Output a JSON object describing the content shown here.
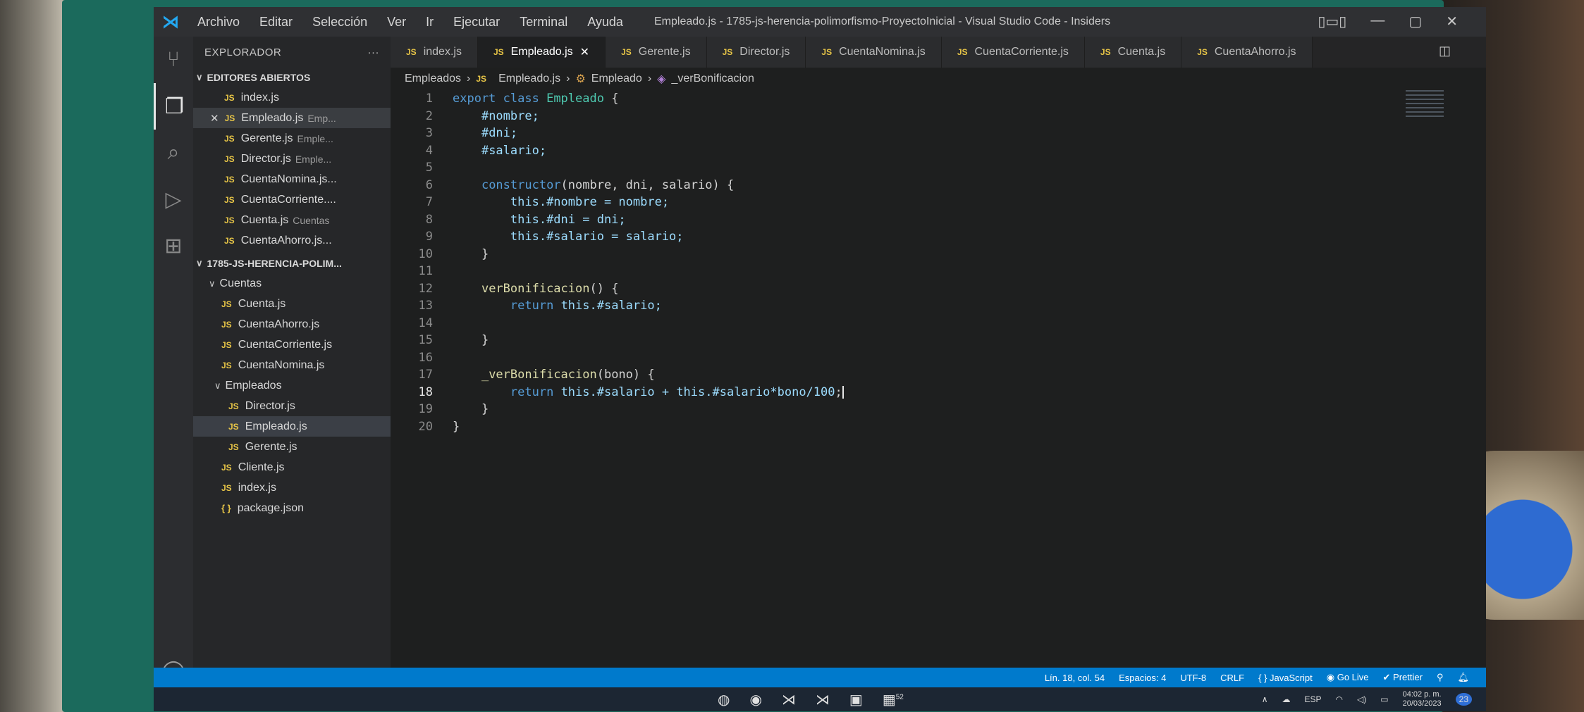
{
  "titlebar": {
    "menu": [
      "Archivo",
      "Editar",
      "Selección",
      "Ver",
      "Ir",
      "Ejecutar",
      "Terminal",
      "Ayuda"
    ],
    "title": "Empleado.js - 1785-js-herencia-polimorfismo-ProyectoInicial - Visual Studio Code - Insiders"
  },
  "sidebar": {
    "header": "EXPLORADOR",
    "more": "···",
    "open_editors_title": "EDITORES ABIERTOS",
    "open_editors": [
      {
        "name": "index.js",
        "desc": ""
      },
      {
        "name": "Empleado.js",
        "desc": "Emp..."
      },
      {
        "name": "Gerente.js",
        "desc": "Emple..."
      },
      {
        "name": "Director.js",
        "desc": "Emple..."
      },
      {
        "name": "CuentaNomina.js...",
        "desc": ""
      },
      {
        "name": "CuentaCorriente....",
        "desc": ""
      },
      {
        "name": "Cuenta.js",
        "desc": "Cuentas"
      },
      {
        "name": "CuentaAhorro.js...",
        "desc": ""
      }
    ],
    "project_title": "1785-JS-HERENCIA-POLIM...",
    "folder_cuentas": "Cuentas",
    "cuentas_files": [
      "Cuenta.js",
      "CuentaAhorro.js",
      "CuentaCorriente.js",
      "CuentaNomina.js"
    ],
    "folder_empleados": "Empleados",
    "empleados_files": [
      "Director.js",
      "Empleado.js",
      "Gerente.js"
    ],
    "root_files": [
      "Cliente.js",
      "index.js"
    ],
    "json_file": "package.json"
  },
  "tabs": [
    "index.js",
    "Empleado.js",
    "Gerente.js",
    "Director.js",
    "CuentaNomina.js",
    "CuentaCorriente.js",
    "Cuenta.js",
    "CuentaAhorro.js"
  ],
  "breadcrumb": {
    "folder": "Empleados",
    "file": "Empleado.js",
    "class": "Empleado",
    "method": "_verBonificacion"
  },
  "code": {
    "lines": [
      "1",
      "2",
      "3",
      "4",
      "5",
      "6",
      "7",
      "8",
      "9",
      "10",
      "11",
      "12",
      "13",
      "14",
      "15",
      "16",
      "17",
      "18",
      "19",
      "20"
    ],
    "l1_kw": "export class",
    "l1_cls": "Empleado",
    "l1_brace": "{",
    "l2": "#nombre;",
    "l3": "#dni;",
    "l4": "#salario;",
    "l6_fn": "constructor",
    "l6_rest": "(nombre, dni, salario) {",
    "l7": "this.#nombre = nombre;",
    "l8": "this.#dni = dni;",
    "l9": "this.#salario = salario;",
    "l10": "}",
    "l12_fn": "verBonificacion",
    "l12_rest": "() {",
    "l13_kw": "return",
    "l13_rest": "this.#salario;",
    "l15": "}",
    "l17_fn": "_verBonificacion",
    "l17_rest": "(bono) {",
    "l18_kw": "return",
    "l18_rest": "this.#salario + this.#salario*bono/100",
    "l19": "}",
    "l20": "}"
  },
  "status": {
    "position": "Lín. 18, col. 54",
    "spaces": "Espacios: 4",
    "encoding": "UTF-8",
    "eol": "CRLF",
    "language": "JavaScript",
    "golive": "Go Live",
    "prettier": "Prettier"
  },
  "taskbar": {
    "lang": "ESP",
    "time": "04:02 p. m.",
    "date": "20/03/2023",
    "notif_count": "23",
    "badge": "52"
  }
}
